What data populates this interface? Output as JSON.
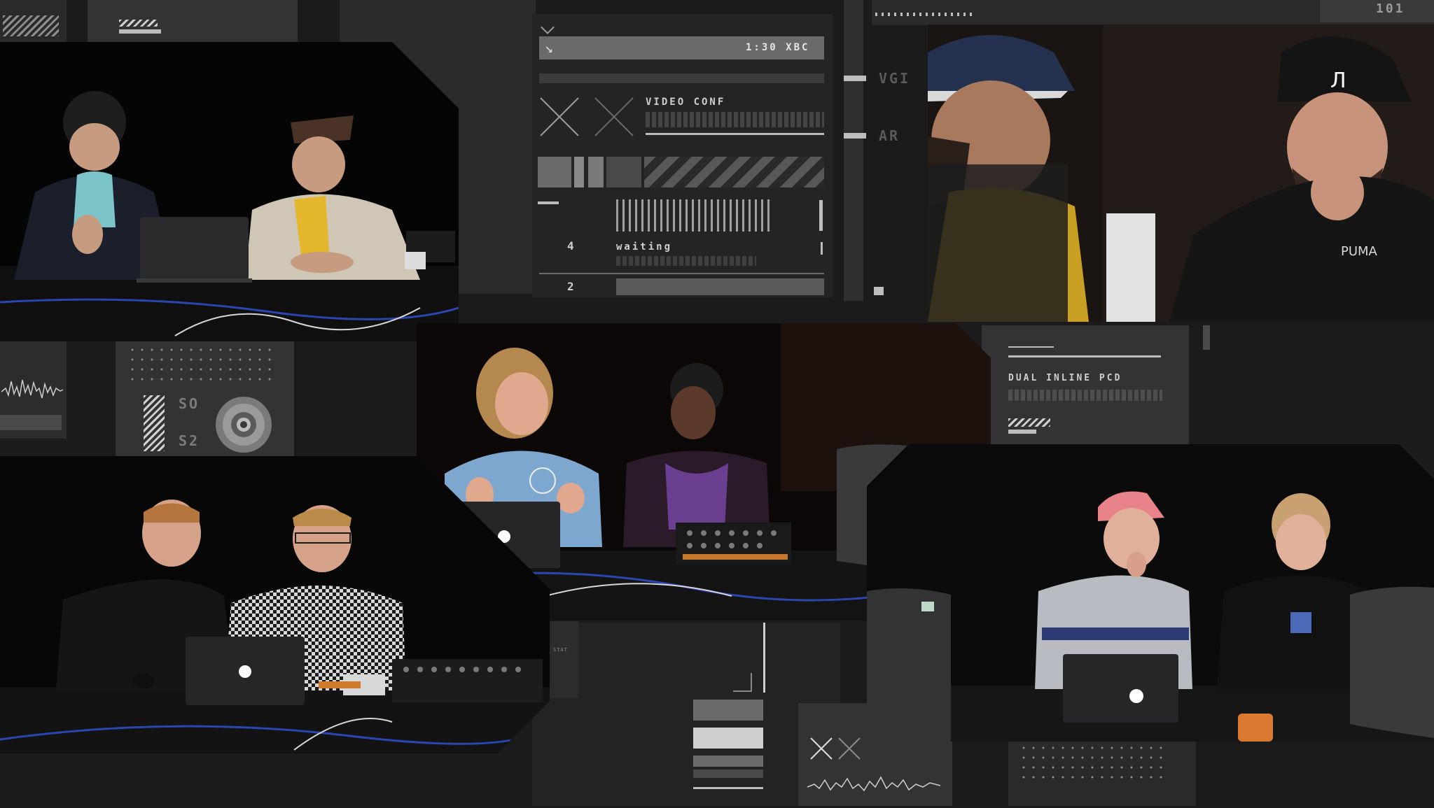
{
  "hud": {
    "top_right_counter": "101",
    "timecode": "1:30 XBC",
    "side_label_1": "VGI",
    "side_label_2": "AR",
    "video_title": "VIDEO CONF",
    "video_subtitle": "waiting",
    "counter_a": "4",
    "counter_b": "2",
    "vinyl_label_top": "SO",
    "vinyl_label_bottom": "S2",
    "dual_title": "DUAL INLINE PCD",
    "small_label": "STAT"
  },
  "colors": {
    "background": "#1b1b1b",
    "panel": "#2a2a2a",
    "accent_light": "#cfcfcf",
    "cable_blue": "#2a46b0"
  },
  "icons": [
    "diagonal-arrow-icon",
    "x-mark-icon",
    "vinyl-record-icon",
    "caret-icon"
  ]
}
